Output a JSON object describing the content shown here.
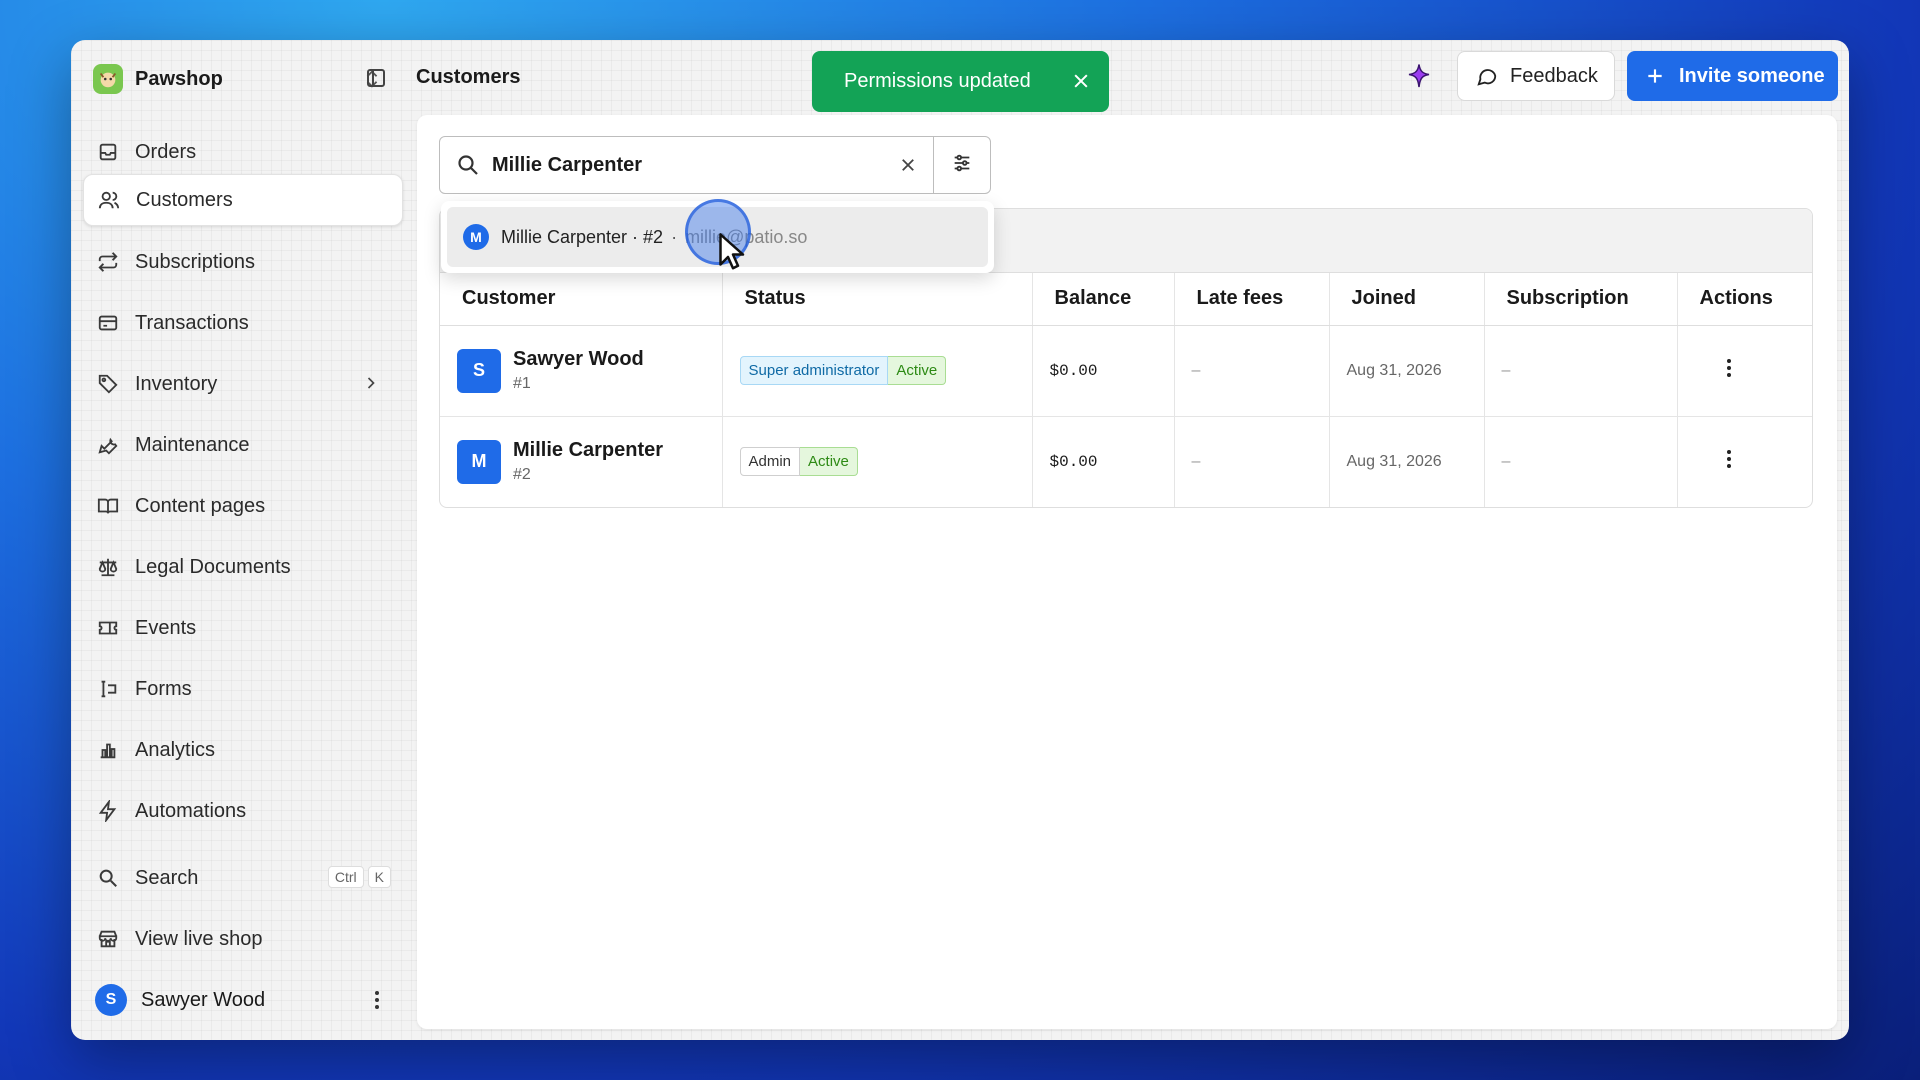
{
  "brand": {
    "name": "Pawshop"
  },
  "page": {
    "title": "Customers"
  },
  "toast": {
    "message": "Permissions updated"
  },
  "header": {
    "feedback_label": "Feedback",
    "invite_label": "Invite someone"
  },
  "sidebar": {
    "items": [
      {
        "label": "Orders",
        "icon": "inbox-icon"
      },
      {
        "label": "Customers",
        "icon": "users-icon",
        "active": true
      },
      {
        "label": "Subscriptions",
        "icon": "repeat-icon"
      },
      {
        "label": "Transactions",
        "icon": "credit-card-icon"
      },
      {
        "label": "Inventory",
        "icon": "tag-icon"
      },
      {
        "label": "Maintenance",
        "icon": "wrench-icon"
      },
      {
        "label": "Content pages",
        "icon": "book-icon"
      },
      {
        "label": "Legal Documents",
        "icon": "scale-icon"
      },
      {
        "label": "Events",
        "icon": "ticket-icon"
      },
      {
        "label": "Forms",
        "icon": "text-cursor-icon"
      },
      {
        "label": "Analytics",
        "icon": "bar-chart-icon"
      },
      {
        "label": "Automations",
        "icon": "bolt-icon"
      }
    ],
    "search": {
      "label": "Search",
      "shortcut": [
        "Ctrl",
        "K"
      ]
    },
    "view_live_shop": "View live shop",
    "user": {
      "initial": "S",
      "name": "Sawyer Wood"
    }
  },
  "search": {
    "value": "Millie Carpenter"
  },
  "suggestion": {
    "initial": "M",
    "name": "Millie Carpenter · #2",
    "separator": "·",
    "email": "millie@patio.so"
  },
  "table": {
    "columns": [
      "Customer",
      "Status",
      "Balance",
      "Late fees",
      "Joined",
      "Subscription",
      "Actions"
    ],
    "rows": [
      {
        "initial": "S",
        "name": "Sawyer Wood",
        "id": "#1",
        "role": "Super administrator",
        "status": "Active",
        "balance": "$0.00",
        "late_fees": "–",
        "joined": "Aug 31, 2026",
        "subscription": "–"
      },
      {
        "initial": "M",
        "name": "Millie Carpenter",
        "id": "#2",
        "role": "Admin",
        "status": "Active",
        "balance": "$0.00",
        "late_fees": "–",
        "joined": "Aug 31, 2026",
        "subscription": "–"
      }
    ]
  },
  "colors": {
    "accent": "#1f6be8",
    "toast": "#13a356",
    "badge_active": "#2d8a14",
    "badge_super": "#0f6aa5"
  }
}
